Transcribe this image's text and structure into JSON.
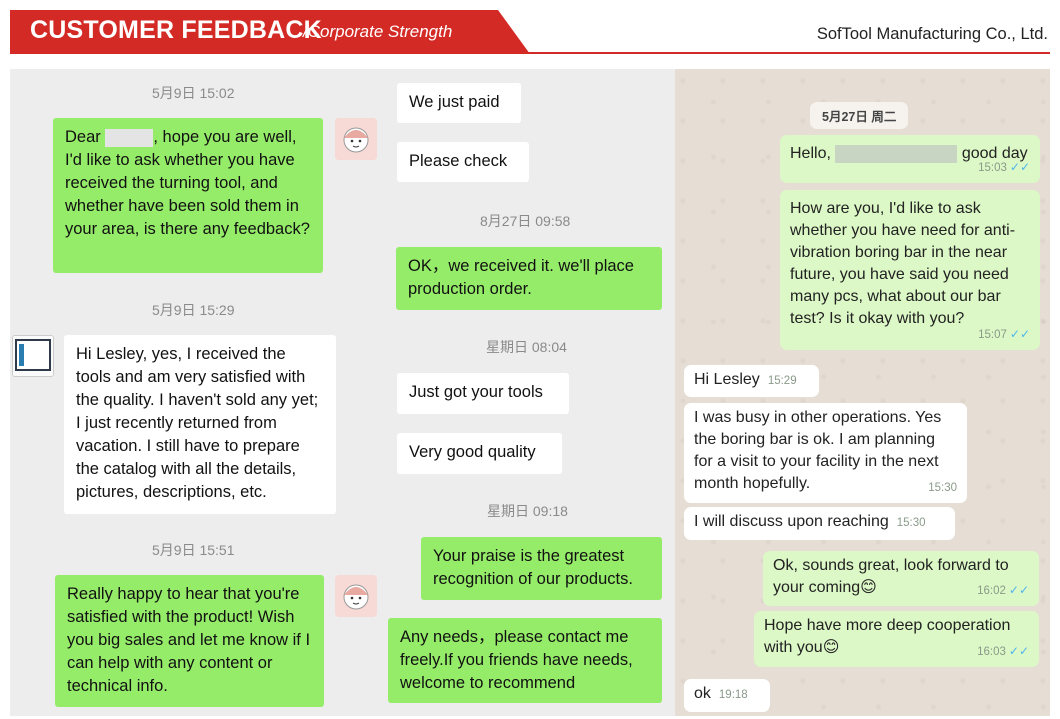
{
  "header": {
    "title": "CUSTOMER FEEDBACK",
    "subtitle": "/Corporate Strength",
    "company": "SofTool Manufacturing Co., Ltd."
  },
  "chat1": {
    "ts1": "5月9日 15:02",
    "msg1_prefix": "Dear",
    "msg1_rest": ", hope you are well, I'd like to ask whether you have received the turning tool, and whether have been sold them in your area, is there any feedback?",
    "ts2": "5月9日 15:29",
    "msg2": "Hi Lesley, yes, I received the tools and am very satisfied with the quality. I haven't sold any yet; I just recently returned from vacation. I still have to prepare the catalog with all the details, pictures, descriptions, etc.",
    "ts3": "5月9日 15:51",
    "msg3": "Really happy to hear that you're satisfied with the product! Wish you big sales and let me know if I can help with any content or technical info."
  },
  "chat2": {
    "msg1": "We just paid",
    "msg2": "Please check",
    "ts1": "8月27日 09:58",
    "msg3": "OK，we received it. we'll place production order.",
    "ts2": "星期日 08:04",
    "msg4": "Just got your tools",
    "msg5": "Very good quality",
    "ts3": "星期日 09:18",
    "msg6": "Your praise is the greatest recognition of our products.",
    "msg7": "Any needs，please contact me freely.If you friends have needs, welcome to recommend"
  },
  "chat3": {
    "date": "5月27日 周二",
    "m1_prefix": "Hello,",
    "m1_suffix": "good day",
    "m1_time": "15:03",
    "m2": "How are you, I'd like to ask whether you have need for anti-vibration boring bar in the near future, you have said you need many pcs, what about our bar test? Is it okay with you?",
    "m2_time": "15:07",
    "m3": "Hi Lesley",
    "m3_time": "15:29",
    "m4": "I was busy in other operations. Yes the boring bar is ok. I am planning for a visit to your facility in the next month hopefully.",
    "m4_time": "15:30",
    "m5": "I will discuss upon reaching",
    "m5_time": "15:30",
    "m6": "Ok, sounds great, look forward to your coming😊",
    "m6_time": "16:02",
    "m7": "Hope have more deep cooperation with you😊",
    "m7_time": "16:03",
    "m8": "ok",
    "m8_time": "19:18"
  },
  "colors": {
    "brand_red": "#d42a26",
    "wechat_green": "#95ec69",
    "whatsapp_green": "#dcf8c6"
  }
}
